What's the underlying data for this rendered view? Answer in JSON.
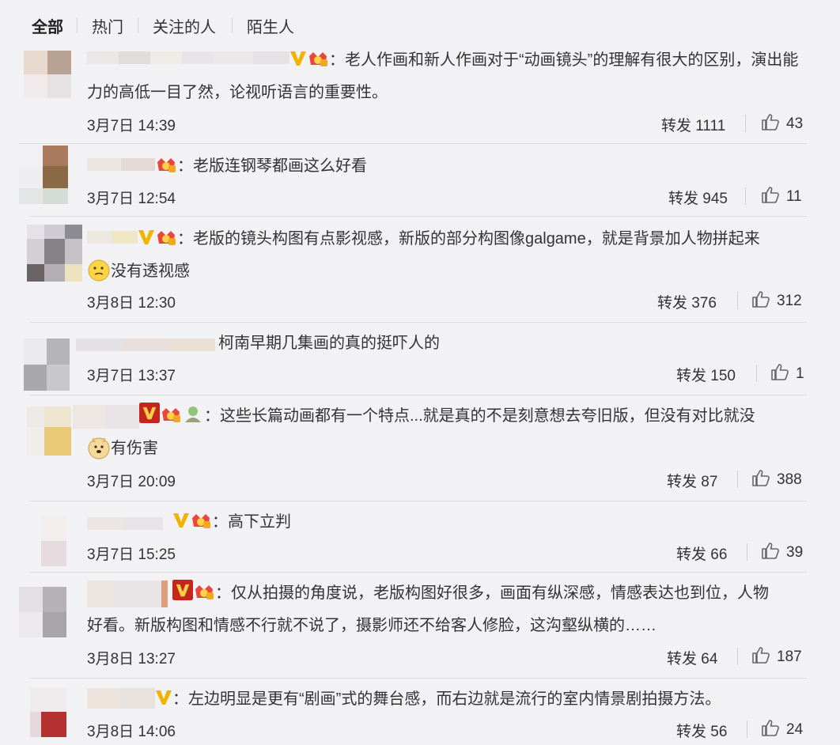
{
  "tabs": [
    "全部",
    "热门",
    "关注的人",
    "陌生人"
  ],
  "comments": [
    {
      "text": "：老人作画和新人作画对于“动画镜头”的理解有很大的区别，演出能力的高低一目了然，论视听语言的重要性。",
      "date": "3月7日 14:39",
      "repost": "转发 1111",
      "likes": "43"
    },
    {
      "text": "：老版连钢琴都画这么好看",
      "date": "3月7日 12:54",
      "repost": "转发 945",
      "likes": "11"
    },
    {
      "text": "：老版的镜头构图有点影视感，新版的部分构图像galgame，就是背景加人物拼起来",
      "text2": "没有透视感",
      "date": "3月8日 12:30",
      "repost": "转发 376",
      "likes": "312"
    },
    {
      "text": "柯南早期几集画的真的挺吓人的",
      "date": "3月7日 13:37",
      "repost": "转发 150",
      "likes": "1"
    },
    {
      "text": "：这些长篇动画都有一个特点...就是真的不是刻意想去夸旧版，但没有对比就没",
      "text2": "有伤害",
      "date": "3月7日 20:09",
      "repost": "转发 87",
      "likes": "388"
    },
    {
      "text": "：高下立判",
      "date": "3月7日 15:25",
      "repost": "转发 66",
      "likes": "39"
    },
    {
      "text": "：仅从拍摄的角度说，老版构图好很多，画面有纵深感，情感表达也到位，人物",
      "text2": "好看。新版构图和情感不行就不说了，摄影师还不给客人修脸，这沟壑纵横的……",
      "date": "3月8日 13:27",
      "repost": "转发 64",
      "likes": "187"
    },
    {
      "text": "：左边明显是更有“剧画”式的舞台感，而右边就是流行的室内情景剧拍摄方法。",
      "date": "3月8日 14:06",
      "repost": "转发 56",
      "likes": "24"
    }
  ],
  "colors": {
    "background": "#f2f2f5",
    "text": "#333333",
    "divider": "#dcdcdf",
    "vip_gold": "#f0b400",
    "vip_red": "#c4261d"
  }
}
